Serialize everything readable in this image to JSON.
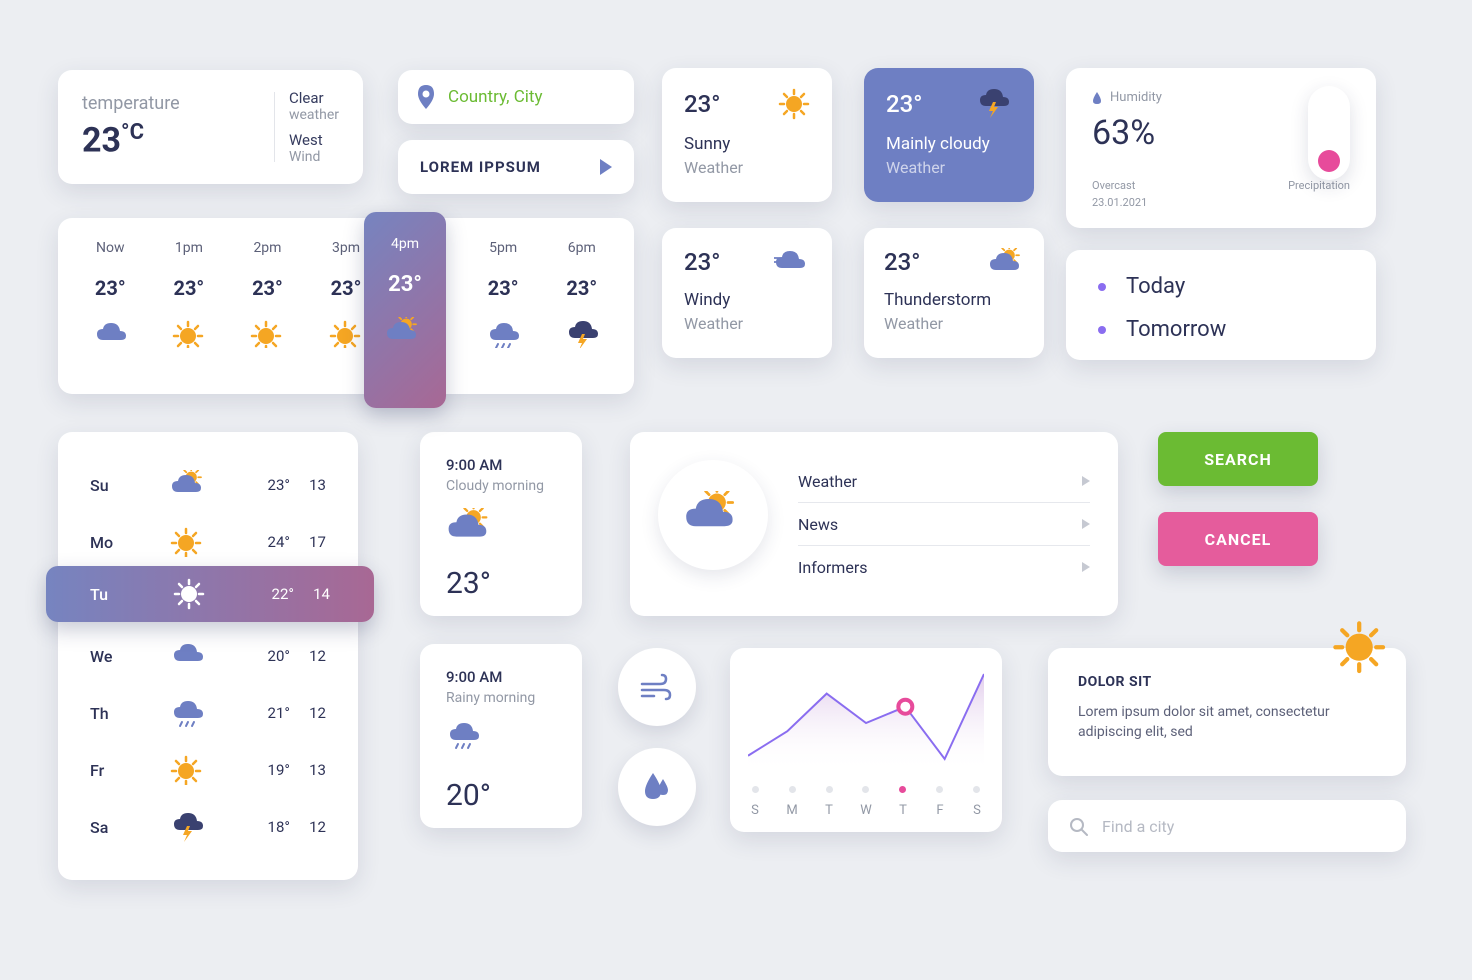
{
  "temp_card": {
    "label": "temperature",
    "value": "23",
    "unit": "°C",
    "cond": "Clear",
    "cond_sub": "weather",
    "wind": "West",
    "wind_sub": "Wind"
  },
  "location": {
    "text": "Country, City"
  },
  "lorem": {
    "text": "LOREM IPPSUM"
  },
  "tiles": {
    "sunny": {
      "temp": "23°",
      "title": "Sunny",
      "sub": "Weather"
    },
    "cloudy": {
      "temp": "23°",
      "title": "Mainly cloudy",
      "sub": "Weather"
    },
    "windy": {
      "temp": "23°",
      "title": "Windy",
      "sub": "Weather"
    },
    "thunder": {
      "temp": "23°",
      "title": "Thunderstorm",
      "sub": "Weather"
    }
  },
  "humidity": {
    "label": "Humidity",
    "value": "63%",
    "overcast": "Overcast",
    "date": "23.01.2021",
    "precip": "Precipitation"
  },
  "today_tomorrow": {
    "today": "Today",
    "tomorrow": "Tomorrow"
  },
  "hourly": [
    {
      "label": "Now",
      "temp": "23°",
      "icon": "cloud"
    },
    {
      "label": "1pm",
      "temp": "23°",
      "icon": "sun"
    },
    {
      "label": "2pm",
      "temp": "23°",
      "icon": "sun"
    },
    {
      "label": "3pm",
      "temp": "23°",
      "icon": "sun"
    },
    {
      "label": "4pm",
      "temp": "23°",
      "icon": "partly"
    },
    {
      "label": "5pm",
      "temp": "23°",
      "icon": "rain"
    },
    {
      "label": "6pm",
      "temp": "23°",
      "icon": "thunder"
    }
  ],
  "weekly": [
    {
      "day": "Su",
      "icon": "partly",
      "hi": "23°",
      "lo": "13"
    },
    {
      "day": "Mo",
      "icon": "sun",
      "hi": "24°",
      "lo": "17"
    },
    {
      "day": "Tu",
      "icon": "sun-w",
      "hi": "22°",
      "lo": "14"
    },
    {
      "day": "We",
      "icon": "cloud",
      "hi": "20°",
      "lo": "12"
    },
    {
      "day": "Th",
      "icon": "rain",
      "hi": "21°",
      "lo": "12"
    },
    {
      "day": "Fr",
      "icon": "sun",
      "hi": "19°",
      "lo": "13"
    },
    {
      "day": "Sa",
      "icon": "thunder",
      "hi": "18°",
      "lo": "12"
    }
  ],
  "morning1": {
    "time": "9:00 AM",
    "sub": "Cloudy morning",
    "temp": "23°"
  },
  "morning2": {
    "time": "9:00 AM",
    "sub": "Rainy morning",
    "temp": "20°"
  },
  "menu": {
    "items": [
      "Weather",
      "News",
      "Informers"
    ]
  },
  "buttons": {
    "search": "SEARCH",
    "cancel": "CANCEL"
  },
  "chart_data": {
    "type": "line",
    "days": [
      "S",
      "M",
      "T",
      "W",
      "T",
      "F",
      "S"
    ],
    "values": [
      40,
      55,
      78,
      60,
      70,
      38,
      90
    ],
    "active_index": 4
  },
  "info": {
    "title": "DOLOR SIT",
    "body": "Lorem ipsum dolor sit amet, consectetur adipiscing elit, sed"
  },
  "search": {
    "placeholder": "Find a city"
  }
}
